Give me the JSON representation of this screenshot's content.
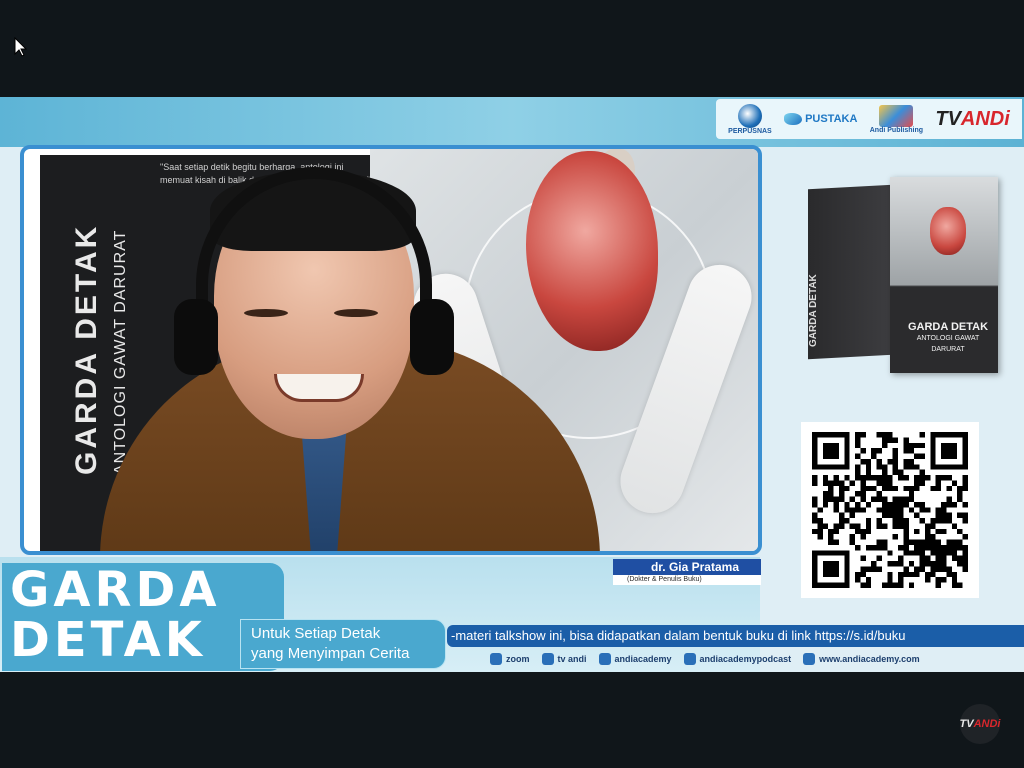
{
  "broadcast": {
    "sponsors": [
      {
        "name": "Perpusnas",
        "label": "PERPUSNAS"
      },
      {
        "name": "Bintang Pustaka",
        "label": "PUSTAKA"
      },
      {
        "name": "Andi Publisher",
        "label": "Andi Publishing"
      },
      {
        "name": "TV Andi",
        "label_prefix": "TV",
        "label_suffix": "ANDi"
      }
    ],
    "banner": {
      "vertical_title": "GARDA DETAK",
      "vertical_subtitle": "ANTOLOGI GAWAT DARURAT",
      "quote": "\"Saat setiap detik begitu berharga, antologi ini memuat kisah di balik detak yang menyimpan cerita\""
    },
    "speaker": {
      "name": "dr. Gia Pratama",
      "role": "(Dokter & Penulis Buku)"
    },
    "book": {
      "title": "GARDA DETAK",
      "subtitle": "ANTOLOGI GAWAT DARURAT",
      "spine": "GARDA DETAK"
    },
    "show": {
      "title_line1": "GARDA",
      "title_line2": "DETAK",
      "tagline_line1": "Untuk Setiap Detak",
      "tagline_line2": "yang Menyimpan Cerita"
    },
    "ticker": "-materi talkshow ini, bisa didapatkan dalam bentuk buku di link https://s.id/buku",
    "socials": [
      {
        "icon": "zoom-icon",
        "label": "zoom"
      },
      {
        "icon": "tv-icon",
        "label": "tv andi"
      },
      {
        "icon": "instagram-icon",
        "label": "andiacademy"
      },
      {
        "icon": "podcast-icon",
        "label": "andiacademypodcast"
      },
      {
        "icon": "web-icon",
        "label": "www.andiacademy.com"
      }
    ],
    "watermark": {
      "prefix": "TV",
      "suffix": "ANDi"
    }
  },
  "colors": {
    "accent_blue": "#1b5ea8",
    "title_teal": "#4aa8cf",
    "brand_red": "#d8262c"
  }
}
